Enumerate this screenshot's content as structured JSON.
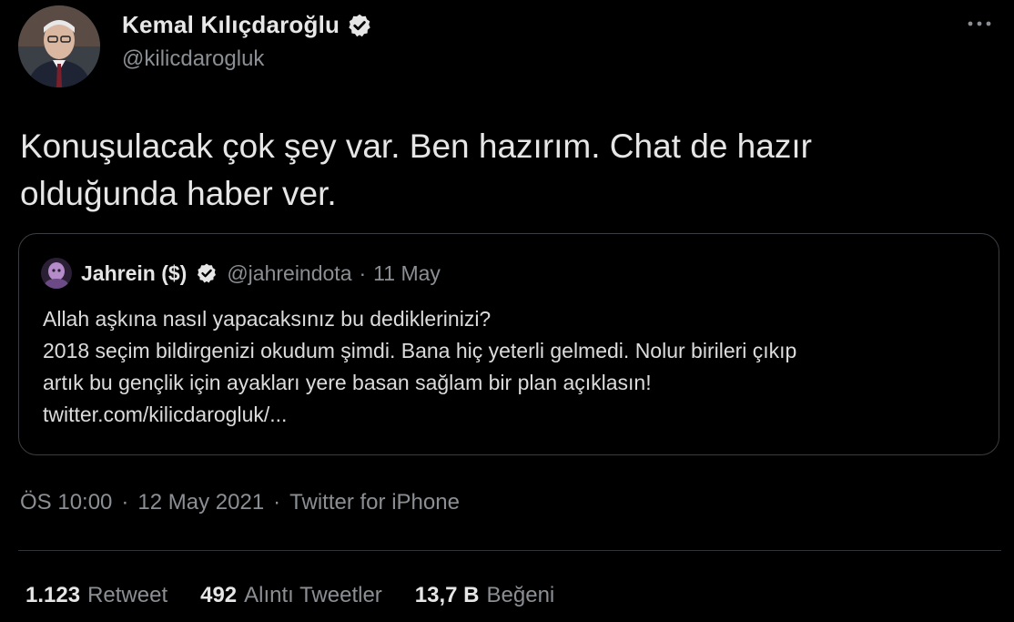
{
  "author": {
    "name": "Kemal Kılıçdaroğlu",
    "handle": "@kilicdarogluk",
    "verified_icon": "verified-badge-icon",
    "avatar_icon": "profile-photo"
  },
  "tweet": {
    "text_line1": "Konuşulacak çok şey var. Ben hazırım. Chat de hazır",
    "text_line2": "olduğunda haber ver."
  },
  "quoted": {
    "name": "Jahrein ($)",
    "handle": "@jahreindota",
    "separator": "·",
    "date": "11 May",
    "lines": [
      "Allah aşkına nasıl yapacaksınız bu dediklerinizi?",
      "2018 seçim bildirgenizi okudum şimdi. Bana hiç yeterli gelmedi. Nolur birileri çıkıp",
      "artık bu gençlik için ayakları yere basan sağlam bir plan açıklasın!",
      "twitter.com/kilicdarogluk/..."
    ]
  },
  "meta": {
    "time": "ÖS 10:00",
    "sep1": "·",
    "date": "12 May 2021",
    "sep2": "·",
    "source": "Twitter for iPhone"
  },
  "stats": {
    "retweets_count": "1.123",
    "retweets_label": "Retweet",
    "quotes_count": "492",
    "quotes_label": "Alıntı Tweetler",
    "likes_count": "13,7 B",
    "likes_label": "Beğeni"
  },
  "colors": {
    "background": "#000000",
    "text_primary": "#e6e6e6",
    "text_secondary": "#8b8f94",
    "border": "#3a3e42"
  }
}
